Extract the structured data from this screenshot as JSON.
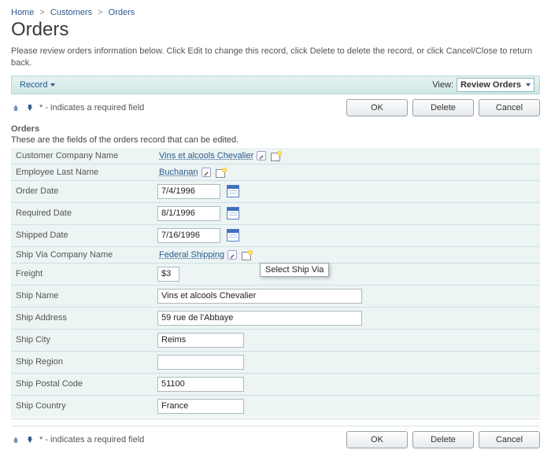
{
  "breadcrumb": {
    "home": "Home",
    "customers": "Customers",
    "orders": "Orders"
  },
  "title": "Orders",
  "blurb": "Please review orders information below. Click Edit to change this record, click Delete to delete the record, or click Cancel/Close to return back.",
  "toolbar": {
    "record": "Record",
    "view_label": "View:",
    "view_value": "Review Orders"
  },
  "hint": "* - indicates a required field",
  "buttons": {
    "ok": "OK",
    "delete": "Delete",
    "cancel": "Cancel"
  },
  "section": {
    "title": "Orders",
    "sub": "These are the fields of the orders record that can be edited."
  },
  "labels": {
    "customer": "Customer Company Name",
    "employee": "Employee Last Name",
    "order_date": "Order Date",
    "required_date": "Required Date",
    "shipped_date": "Shipped Date",
    "ship_via": "Ship Via Company Name",
    "freight": "Freight",
    "ship_name": "Ship Name",
    "ship_address": "Ship Address",
    "ship_city": "Ship City",
    "ship_region": "Ship Region",
    "ship_postal": "Ship Postal Code",
    "ship_country": "Ship Country"
  },
  "values": {
    "customer": "Vins et alcools Chevalier",
    "employee": "Buchanan",
    "order_date": "7/4/1996",
    "required_date": "8/1/1996",
    "shipped_date": "7/16/1996",
    "ship_via": "Federal Shipping",
    "freight": "$3",
    "ship_name": "Vins et alcools Chevalier",
    "ship_address": "59 rue de l'Abbaye",
    "ship_city": "Reims",
    "ship_region": "",
    "ship_postal": "51100",
    "ship_country": "France"
  },
  "tooltip": "Select Ship Via"
}
